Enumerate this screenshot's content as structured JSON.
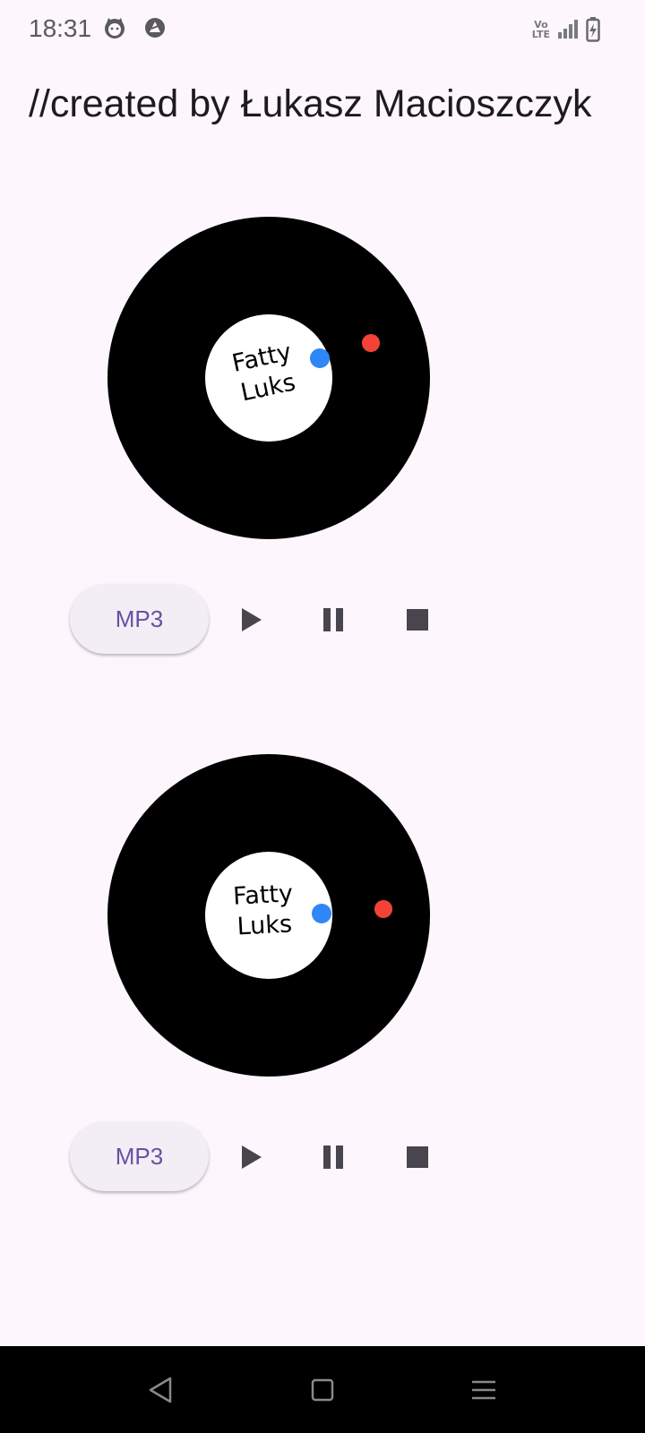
{
  "status_bar": {
    "time": "18:31",
    "notification_icons": [
      "cat-face-icon",
      "app-notification-icon"
    ],
    "network": "VoLTE",
    "volte_line1": "Vo",
    "volte_line2": "LTE",
    "signal_icon": "signal-bars-icon",
    "battery_icon": "battery-charging-icon"
  },
  "header": {
    "title": "//created by Łukasz Macioszczyk"
  },
  "decks": [
    {
      "label_line1": "Fatty",
      "label_line2": "Luks",
      "controls": {
        "mp3_label": "MP3",
        "play_icon": "play-icon",
        "pause_icon": "pause-icon",
        "stop_icon": "stop-icon"
      }
    },
    {
      "label_line1": "Fatty",
      "label_line2": "Luks",
      "controls": {
        "mp3_label": "MP3",
        "play_icon": "play-icon",
        "pause_icon": "pause-icon",
        "stop_icon": "stop-icon"
      }
    }
  ],
  "colors": {
    "background": "#fdf7fd",
    "disc": "#000000",
    "label": "#ffffff",
    "blue_marker": "#2f86f6",
    "red_marker": "#f44336",
    "accent": "#6750a4",
    "icon": "#49454f"
  },
  "nav_bar": {
    "back_icon": "back-triangle-icon",
    "home_icon": "home-square-icon",
    "recents_icon": "menu-lines-icon"
  }
}
